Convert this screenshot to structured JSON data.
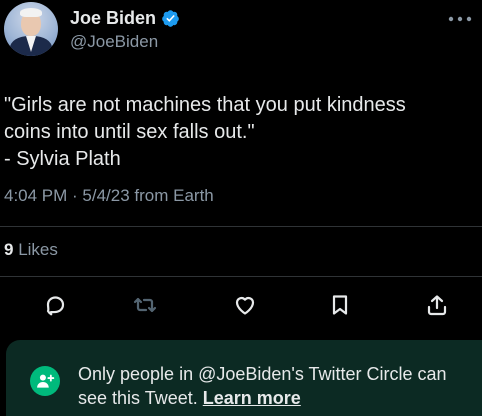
{
  "author": {
    "display_name": "Joe Biden",
    "handle": "@JoeBiden"
  },
  "tweet": {
    "text": "\"Girls are not machines that you put kindness\ncoins into until sex falls out.\"\n- Sylvia Plath",
    "timestamp": "4:04 PM · 5/4/23 from Earth"
  },
  "stats": {
    "likes_count": "9",
    "likes_label": "Likes"
  },
  "actions": {
    "reply_icon": "reply-icon",
    "retweet_icon": "retweet-icon",
    "like_icon": "heart-icon",
    "bookmark_icon": "bookmark-icon",
    "share_icon": "share-icon"
  },
  "circle_notice": {
    "text": "Only people in @JoeBiden's Twitter Circle can see this Tweet.",
    "learn_more": "Learn more"
  },
  "colors": {
    "background": "#000000",
    "text_primary": "#e7e9ea",
    "text_secondary": "#8b98a5",
    "verified_blue": "#1d9bf0",
    "circle_green": "#00ba7c",
    "circle_bg": "#0c2a23"
  }
}
